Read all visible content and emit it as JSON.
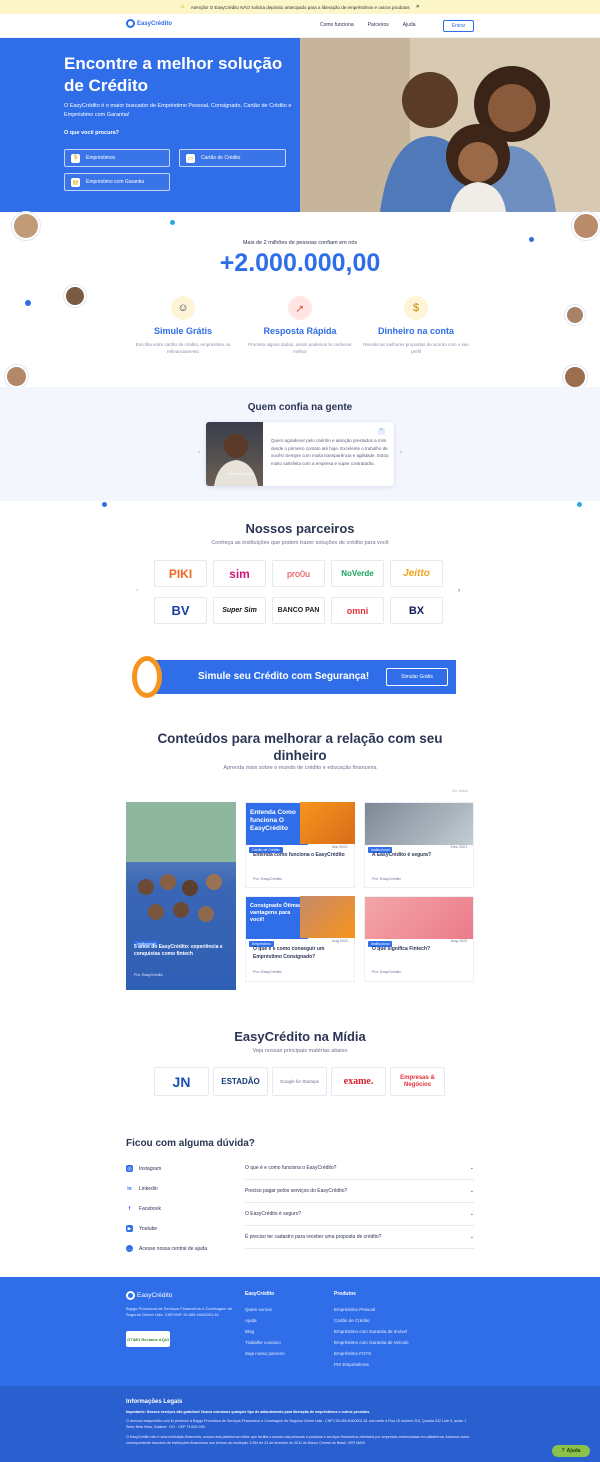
{
  "banner": {
    "text": "Atenção! O EasyCrédito NÃO solicita depósito antecipado para a liberação de empréstimos e outros produtos",
    "close": "✕"
  },
  "nav": {
    "logo": "EasyCrédito",
    "links": [
      "Como funciona",
      "Parceiros",
      "Ajuda"
    ],
    "login": "Entrar"
  },
  "hero": {
    "title": "Encontre a melhor solução de Crédito",
    "subtitle": "O EasyCrédito é o maior buscador de Empréstimo Pessoal, Consignado, Cartão de Crédito e Empréstimo com Garantia!",
    "question": "O que você procura?",
    "options": [
      "Empréstimos",
      "Cartão de Crédito",
      "Empréstimo com Garantia"
    ]
  },
  "stats": {
    "caption": "Mais de 2 milhões de pessoas confiam em nós",
    "number": "+2.000.000,00"
  },
  "features": [
    {
      "title": "Simule Grátis",
      "desc": "Escolha entre cartão de crédito, empréstimo ou refinanciamento"
    },
    {
      "title": "Resposta Rápida",
      "desc": "Prometa alguns dados, assim podemos te conhecer melhor"
    },
    {
      "title": "Dinheiro na conta",
      "desc": "Receba as melhores propostas de acordo com o seu perfil"
    }
  ],
  "trust": {
    "title": "Quem confia na gente",
    "quote": "Quero agradecer pelo carinho e atenção prestados a mim desde o primeiro contato até hoje. Excelente o trabalho de vocês! Sempre com muita transparência e agilidade. Estou muito satisfeita com a empresa e super contratarão.",
    "name": "Helena Nunes"
  },
  "partners": {
    "title": "Nossos parceiros",
    "subtitle": "Conheça as instituições que podem trazer soluções de crédito para você",
    "logos": [
      "PIKI",
      "sim",
      "pro0u",
      "NoVerde",
      "Jeitto",
      "BV",
      "Super Sim",
      "BANCO PAN",
      "omni",
      "BX"
    ]
  },
  "cta": {
    "text": "Simule seu Crédito com Segurança!",
    "button": "Simular Grátis"
  },
  "content": {
    "title": "Conteúdos para melhorar a relação com seu dinheiro",
    "subtitle": "Aprenda mais sobre o mundo de crédito e educação financeira",
    "see_all": "Ver todos",
    "featured": {
      "tag": "Institucional",
      "title": "5 anos do EasyCrédito: experiência e conquistas como fintech",
      "author": "Por: EasyCrédito"
    },
    "cards": [
      {
        "banner": "Entenda Como funciona O EasyCrédito",
        "tag": "Cartão de Crédito",
        "date": "Mai 2022",
        "title": "Entenda como funciona o EasyCrédito",
        "author": "Por: EasyCrédito"
      },
      {
        "banner": "",
        "tag": "Institucional",
        "date": "Dez 2021",
        "title": "A EasyCrédito é segura?",
        "author": "Por: EasyCrédito"
      },
      {
        "banner": "Consignado Ótimas vantagens para você!",
        "tag": "Empréstimo",
        "date": "Aug 2022",
        "title": "O que é e como conseguir um Empréstimo Consignado?",
        "author": "Por: EasyCrédito"
      },
      {
        "banner": "",
        "tag": "Institucional",
        "date": "Aug 2022",
        "title": "O que significa Fintech?",
        "author": "Por: EasyCrédito"
      }
    ]
  },
  "media": {
    "title": "EasyCrédito na Mídia",
    "subtitle": "Veja nossas principais matérias abaixo",
    "logos": [
      "JN",
      "ESTADÃO",
      "Google for Startups",
      "exame.",
      "Empresas & Negócios"
    ]
  },
  "faq": {
    "title": "Ficou com alguma dúvida?",
    "social": [
      "Instagram",
      "Linkedin",
      "Facebook",
      "Youtube",
      "Acesse nossa central de ajuda"
    ],
    "questions": [
      "O que é e como funciona o EasyCrédito?",
      "Preciso pagar pelos serviços do EasyCrédito?",
      "O EasyCrédito é seguro?",
      "É preciso ter cadastro para receber uma proposta de crédito?"
    ]
  },
  "footer": {
    "logo": "EasyCrédito",
    "company": "Baygo Promotora de Serviços Financeiros e Corretagem de Seguros Online Ltda. CNPJ/MF 26.089.404/0001-61",
    "seal": "ÓTIMO Reclame AQUI",
    "col1": {
      "title": "EasyCrédito",
      "links": [
        "Quem somos",
        "Ajuda",
        "Blog",
        "Trabalhe conosco",
        "Seja nosso parceiro"
      ]
    },
    "col2": {
      "title": "Produtos",
      "links": [
        "Empréstimo Pessoal",
        "Cartão de Crédito",
        "Empréstimo com Garantia de Imóvel",
        "Empréstimo com Garantia de Veículo",
        "Empréstimo FGTS",
        "PIX Empréstimos"
      ]
    },
    "legal_title": "Informações Legais",
    "legal": [
      "Importante: Nossos serviços são gratuitos! Nunca cobramos qualquer tipo de adiantamento para liberação de empréstimos e outros produtos.",
      "O domínio easycredito.com.br pertence à Baygo Promotora de Serviços Financeiros e Corretagem de Seguros Online Ltda · CNPJ 26.089.404/0001-61 com sede à Rua 15 número 224, Quadra 032 Lote 9, andar 1 Setor Bela Vista, Goiânia · GO · CEP 74.810-035.",
      "O EasyCrédito não é uma instituição financeira, somos uma plataforma online que facilita o acesso das pessoas a produtos e serviços financeiros ofertados por empresas credenciadas em plataforma. Atuamos como correspondente bancário de instituições financeiras nos termos da resolução 3.954 de 24 de fevereiro de 2011 do Banco Central do Brasil. VER MAIS"
    ],
    "help": "Ajuda"
  },
  "colors": {
    "primary": "#2f6ee8",
    "accent": "#f7941d",
    "banner_bg": "#fdf6c9"
  }
}
